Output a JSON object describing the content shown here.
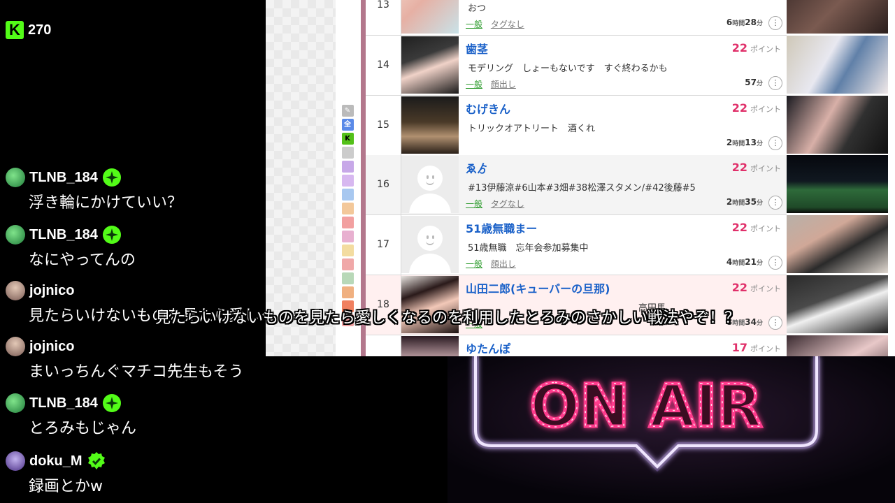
{
  "kick": {
    "viewer_count": "270",
    "logo_letter": "K",
    "brand_color": "#53fc18"
  },
  "chat": [
    {
      "user": "TLNB_184",
      "text": "浮き輪にかけていい？",
      "avatar": "avatar-tlnb",
      "badge": "og-badge"
    },
    {
      "user": "TLNB_184",
      "text": "なにやってんの",
      "avatar": "avatar-tlnb",
      "badge": "og-badge"
    },
    {
      "user": "jojnico",
      "text": "見たらいけないものを見たら愛しくなるのを利用したとろみのさかしい戦法やぞ！？",
      "avatar": "avatar-jojnico",
      "badge": ""
    },
    {
      "user": "jojnico",
      "text": "まいっちんぐマチコ先生もそう",
      "avatar": "avatar-jojnico",
      "badge": ""
    },
    {
      "user": "TLNB_184",
      "text": "とろみもじゃん",
      "avatar": "avatar-tlnb",
      "badge": "og-badge"
    },
    {
      "user": "doku_M",
      "text": "録画とかw",
      "avatar": "avatar-doku",
      "badge": "verified-badge"
    }
  ],
  "side_icons": [
    "全",
    "K"
  ],
  "ranking": {
    "point_unit": "ポイント",
    "hour_unit": "時間",
    "minute_unit": "分",
    "rows": [
      {
        "rank": "13",
        "name": "",
        "desc": "おつ",
        "category": "一般",
        "tag": "タグなし",
        "points": "",
        "hours": "6",
        "minutes": "28"
      },
      {
        "rank": "14",
        "name": "歯茎",
        "desc": "モデリング　しょーもないです　すぐ終わるかも",
        "category": "一般",
        "tag": "顔出し",
        "points": "22",
        "hours": "",
        "minutes": "57"
      },
      {
        "rank": "15",
        "name": "むげきん",
        "desc": "トリックオアトリート　酒くれ",
        "category": "",
        "tag": "",
        "points": "22",
        "hours": "2",
        "minutes": "13"
      },
      {
        "rank": "16",
        "name": "ゑゟ",
        "desc": "#13伊藤涼#6山本#3畑#38松澤スタメン/#42後藤#5",
        "category": "一般",
        "tag": "タグなし",
        "points": "22",
        "hours": "2",
        "minutes": "35"
      },
      {
        "rank": "17",
        "name": "51歳無職まー",
        "desc": "51歳無職　忘年会参加募集中",
        "category": "一般",
        "tag": "顔出し",
        "points": "22",
        "hours": "4",
        "minutes": "21"
      },
      {
        "rank": "18",
        "name": "山田二郎(キューバーの旦那)",
        "desc": "高田馬",
        "category": "一般",
        "tag": "",
        "points": "22",
        "hours": "8",
        "minutes": "34"
      },
      {
        "rank": "",
        "name": "ゆたんぽ",
        "desc": "",
        "category": "",
        "tag": "",
        "points": "17",
        "hours": "",
        "minutes": ""
      }
    ]
  },
  "subtitle": "見たらいけないものを見たら愛しくなるのを利用したとろみのさかしい戦法やぞ！？",
  "onair": {
    "text": "ON AIR",
    "neon_color": "#ff3a8c",
    "frame_color": "#e8d8ff"
  }
}
